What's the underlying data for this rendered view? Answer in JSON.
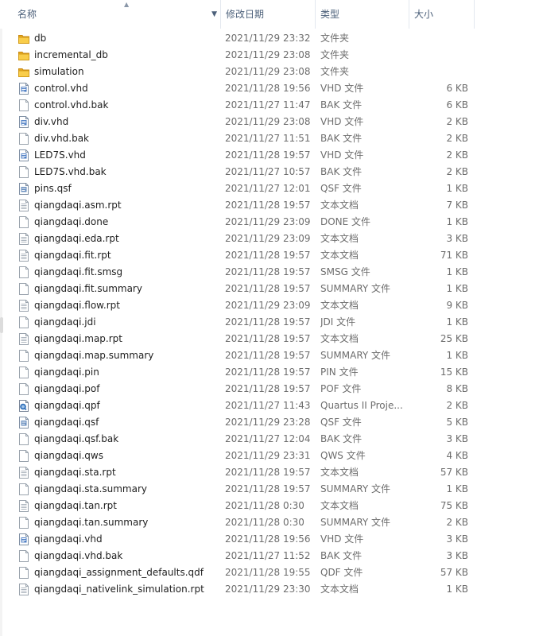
{
  "header": {
    "name": "名称",
    "date": "修改日期",
    "type": "类型",
    "size": "大小"
  },
  "files": [
    {
      "name": "db",
      "date": "2021/11/29 23:32",
      "type": "文件夹",
      "size": "",
      "icon": "folder-icon"
    },
    {
      "name": "incremental_db",
      "date": "2021/11/29 23:08",
      "type": "文件夹",
      "size": "",
      "icon": "folder-icon"
    },
    {
      "name": "simulation",
      "date": "2021/11/29 23:08",
      "type": "文件夹",
      "size": "",
      "icon": "folder-icon"
    },
    {
      "name": "control.vhd",
      "date": "2021/11/28 19:56",
      "type": "VHD 文件",
      "size": "6 KB",
      "icon": "vhd-file-icon"
    },
    {
      "name": "control.vhd.bak",
      "date": "2021/11/27 11:47",
      "type": "BAK 文件",
      "size": "6 KB",
      "icon": "file-icon"
    },
    {
      "name": "div.vhd",
      "date": "2021/11/29 23:08",
      "type": "VHD 文件",
      "size": "2 KB",
      "icon": "vhd-file-icon"
    },
    {
      "name": "div.vhd.bak",
      "date": "2021/11/27 11:51",
      "type": "BAK 文件",
      "size": "2 KB",
      "icon": "file-icon"
    },
    {
      "name": "LED7S.vhd",
      "date": "2021/11/28 19:57",
      "type": "VHD 文件",
      "size": "2 KB",
      "icon": "vhd-file-icon"
    },
    {
      "name": "LED7S.vhd.bak",
      "date": "2021/11/27 10:57",
      "type": "BAK 文件",
      "size": "2 KB",
      "icon": "file-icon"
    },
    {
      "name": "pins.qsf",
      "date": "2021/11/27 12:01",
      "type": "QSF 文件",
      "size": "1 KB",
      "icon": "qsf-file-icon"
    },
    {
      "name": "qiangdaqi.asm.rpt",
      "date": "2021/11/28 19:57",
      "type": "文本文档",
      "size": "7 KB",
      "icon": "text-file-icon"
    },
    {
      "name": "qiangdaqi.done",
      "date": "2021/11/29 23:09",
      "type": "DONE 文件",
      "size": "1 KB",
      "icon": "file-icon"
    },
    {
      "name": "qiangdaqi.eda.rpt",
      "date": "2021/11/29 23:09",
      "type": "文本文档",
      "size": "3 KB",
      "icon": "text-file-icon"
    },
    {
      "name": "qiangdaqi.fit.rpt",
      "date": "2021/11/28 19:57",
      "type": "文本文档",
      "size": "71 KB",
      "icon": "text-file-icon"
    },
    {
      "name": "qiangdaqi.fit.smsg",
      "date": "2021/11/28 19:57",
      "type": "SMSG 文件",
      "size": "1 KB",
      "icon": "file-icon"
    },
    {
      "name": "qiangdaqi.fit.summary",
      "date": "2021/11/28 19:57",
      "type": "SUMMARY 文件",
      "size": "1 KB",
      "icon": "file-icon"
    },
    {
      "name": "qiangdaqi.flow.rpt",
      "date": "2021/11/29 23:09",
      "type": "文本文档",
      "size": "9 KB",
      "icon": "text-file-icon"
    },
    {
      "name": "qiangdaqi.jdi",
      "date": "2021/11/28 19:57",
      "type": "JDI 文件",
      "size": "1 KB",
      "icon": "file-icon"
    },
    {
      "name": "qiangdaqi.map.rpt",
      "date": "2021/11/28 19:57",
      "type": "文本文档",
      "size": "25 KB",
      "icon": "text-file-icon"
    },
    {
      "name": "qiangdaqi.map.summary",
      "date": "2021/11/28 19:57",
      "type": "SUMMARY 文件",
      "size": "1 KB",
      "icon": "file-icon"
    },
    {
      "name": "qiangdaqi.pin",
      "date": "2021/11/28 19:57",
      "type": "PIN 文件",
      "size": "15 KB",
      "icon": "file-icon"
    },
    {
      "name": "qiangdaqi.pof",
      "date": "2021/11/28 19:57",
      "type": "POF 文件",
      "size": "8 KB",
      "icon": "file-icon"
    },
    {
      "name": "qiangdaqi.qpf",
      "date": "2021/11/27 11:43",
      "type": "Quartus II Proje...",
      "size": "2 KB",
      "icon": "quartus-project-icon"
    },
    {
      "name": "qiangdaqi.qsf",
      "date": "2021/11/29 23:28",
      "type": "QSF 文件",
      "size": "5 KB",
      "icon": "qsf-file-icon"
    },
    {
      "name": "qiangdaqi.qsf.bak",
      "date": "2021/11/27 12:04",
      "type": "BAK 文件",
      "size": "3 KB",
      "icon": "file-icon"
    },
    {
      "name": "qiangdaqi.qws",
      "date": "2021/11/29 23:31",
      "type": "QWS 文件",
      "size": "4 KB",
      "icon": "file-icon"
    },
    {
      "name": "qiangdaqi.sta.rpt",
      "date": "2021/11/28 19:57",
      "type": "文本文档",
      "size": "57 KB",
      "icon": "text-file-icon"
    },
    {
      "name": "qiangdaqi.sta.summary",
      "date": "2021/11/28 19:57",
      "type": "SUMMARY 文件",
      "size": "1 KB",
      "icon": "file-icon"
    },
    {
      "name": "qiangdaqi.tan.rpt",
      "date": "2021/11/28 0:30",
      "type": "文本文档",
      "size": "75 KB",
      "icon": "text-file-icon"
    },
    {
      "name": "qiangdaqi.tan.summary",
      "date": "2021/11/28 0:30",
      "type": "SUMMARY 文件",
      "size": "2 KB",
      "icon": "file-icon"
    },
    {
      "name": "qiangdaqi.vhd",
      "date": "2021/11/28 19:56",
      "type": "VHD 文件",
      "size": "3 KB",
      "icon": "vhd-file-icon"
    },
    {
      "name": "qiangdaqi.vhd.bak",
      "date": "2021/11/27 11:52",
      "type": "BAK 文件",
      "size": "3 KB",
      "icon": "file-icon"
    },
    {
      "name": "qiangdaqi_assignment_defaults.qdf",
      "date": "2021/11/28 19:55",
      "type": "QDF 文件",
      "size": "57 KB",
      "icon": "file-icon"
    },
    {
      "name": "qiangdaqi_nativelink_simulation.rpt",
      "date": "2021/11/29 23:30",
      "type": "文本文档",
      "size": "1 KB",
      "icon": "text-file-icon"
    }
  ]
}
